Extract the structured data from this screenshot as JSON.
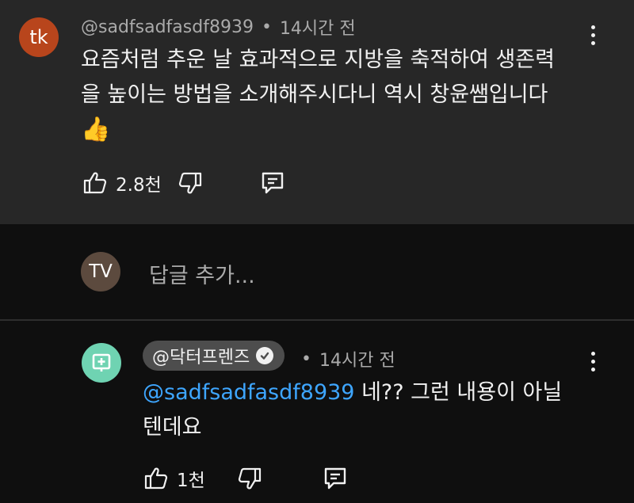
{
  "comment": {
    "avatar_text": "tk",
    "avatar_color": "#b8451c",
    "author": "@sadfsadfasdf8939",
    "separator": "•",
    "time": "14시간 전",
    "line1": "요즘처럼 추운 날 효과적으로 지방을 축적하여 생존력",
    "line2": "을 높이는 방법을 소개해주시다니 역시 창윤쌤입니다",
    "emoji": "👍",
    "like_count": "2.8천"
  },
  "reply_input": {
    "avatar_text": "TV",
    "avatar_color": "#5c4a3e",
    "placeholder": "답글 추가..."
  },
  "reply": {
    "avatar_color": "#6fd3b2",
    "author": "@닥터프렌즈",
    "separator": "•",
    "time": "14시간 전",
    "mention": "@sadfsadfasdf8939",
    "text_line1": " 네?? 그런 내용이 아닐",
    "text_line2": "텐데요",
    "like_count": "1천"
  }
}
